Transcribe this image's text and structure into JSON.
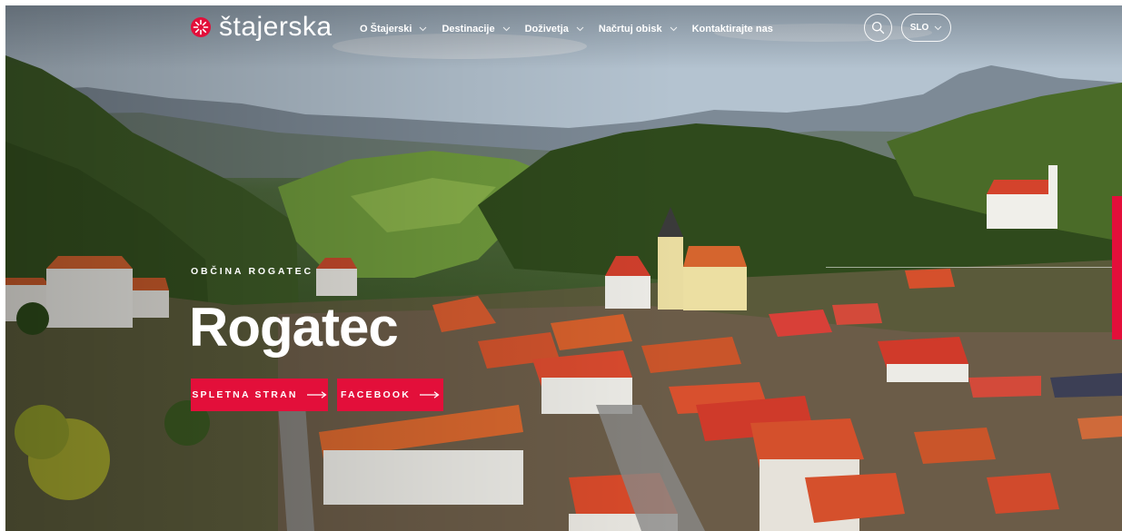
{
  "brand": {
    "name": "štajerska",
    "accent_color": "#e30f3a"
  },
  "nav": {
    "items": [
      {
        "label": "O Štajerski",
        "has_dropdown": true
      },
      {
        "label": "Destinacije",
        "has_dropdown": true
      },
      {
        "label": "Doživetja",
        "has_dropdown": true
      },
      {
        "label": "Načrtuj obisk",
        "has_dropdown": true
      },
      {
        "label": "Kontaktirajte nas",
        "has_dropdown": false
      }
    ],
    "search_icon": "search-icon",
    "language": "SLO"
  },
  "hero": {
    "eyebrow": "OBČINA ROGATEC",
    "title": "Rogatec",
    "buttons": [
      {
        "label": "SPLETNA STRAN",
        "icon": "arrow-right-icon"
      },
      {
        "label": "FACEBOOK",
        "icon": "arrow-right-icon"
      }
    ]
  }
}
